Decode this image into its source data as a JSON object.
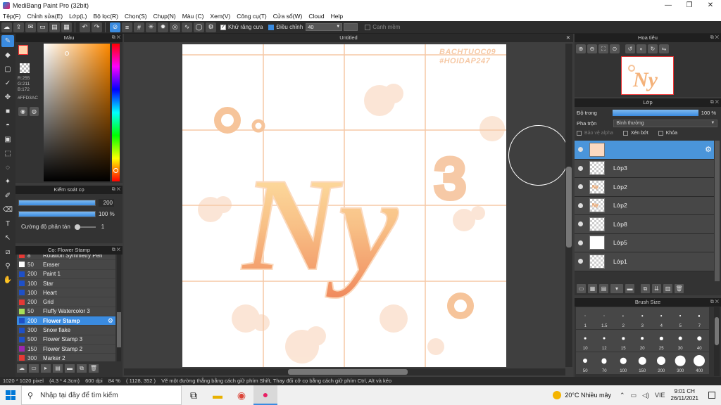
{
  "window": {
    "title": "MediBang Paint Pro (32bit)",
    "minimize": "—",
    "maximize": "❐",
    "close": "✕"
  },
  "menu": [
    "Tệp(F)",
    "Chỉnh sửa(E)",
    "Lớp(L)",
    "Bộ lọc(R)",
    "Chọn(S)",
    "Chụp(N)",
    "Màu (C)",
    "Xem(V)",
    "Công cụ(T)",
    "Cửa sổ(W)",
    "Cloud",
    "Help"
  ],
  "toolbar": {
    "antialias_label": "Khử răng cưa",
    "antialias_checked": true,
    "correction_label": "Điều chỉnh",
    "correction_value": "40",
    "snap_label": "Canh mềm",
    "snap_checked": false
  },
  "color_panel": {
    "title": "Màu",
    "foreground_color": "#FFD3AC",
    "r": "R:255",
    "g": "G:211",
    "b": "B:172",
    "hex": "#FFD3AC"
  },
  "brush_control": {
    "title": "Kiểm soát cọ",
    "size_value": "200",
    "opacity_value": "100 %",
    "scatter_label": "Cường độ phân tán",
    "scatter_value": "1"
  },
  "brush_list": {
    "title": "Cọ: Flower Stamp",
    "items": [
      {
        "size": "8",
        "name": "Rotation Symmetry Pen",
        "color": "#e53935",
        "selected": false
      },
      {
        "size": "50",
        "name": "Eraser",
        "color": "#ffffff",
        "selected": false
      },
      {
        "size": "200",
        "name": "Paint 1",
        "color": "#1e50c8",
        "selected": false
      },
      {
        "size": "100",
        "name": "Star",
        "color": "#1e50c8",
        "selected": false
      },
      {
        "size": "100",
        "name": "Heart",
        "color": "#1e50c8",
        "selected": false
      },
      {
        "size": "200",
        "name": "Grid",
        "color": "#e53935",
        "selected": false
      },
      {
        "size": "50",
        "name": "Fluffy Watercolor 3",
        "color": "#a6e05a",
        "selected": false
      },
      {
        "size": "200",
        "name": "Flower Stamp",
        "color": "#1e50c8",
        "selected": true
      },
      {
        "size": "300",
        "name": "Snow flake",
        "color": "#1e50c8",
        "selected": false
      },
      {
        "size": "500",
        "name": "Flower Stamp 3",
        "color": "#1e50c8",
        "selected": false
      },
      {
        "size": "150",
        "name": "Flower Stamp 2",
        "color": "#9c27b0",
        "selected": false
      },
      {
        "size": "300",
        "name": "Marker 2",
        "color": "#e53935",
        "selected": false
      }
    ]
  },
  "canvas": {
    "tab_title": "Untitled",
    "watermark_line1": "BACHTUOC09",
    "watermark_line2": "#HOIDAP247",
    "art_text": "Ny",
    "art_superscript": "3"
  },
  "navigator": {
    "title": "Hoa tiêu"
  },
  "layer_panel": {
    "title": "Lớp",
    "opacity_label": "Độ trong",
    "opacity_value": "100 %",
    "blend_label": "Pha trộn",
    "blend_value": "Bình thường",
    "protect_alpha": "Bảo vệ alpha",
    "clipping": "Xén bớt",
    "lock": "Khóa",
    "layers": [
      {
        "name": "",
        "selected": true,
        "thumb": "peach"
      },
      {
        "name": "Lớp3",
        "selected": false,
        "thumb": "empty"
      },
      {
        "name": "Lớp2",
        "selected": false,
        "thumb": "ny"
      },
      {
        "name": "Lớp2",
        "selected": false,
        "thumb": "ny"
      },
      {
        "name": "Lớp8",
        "selected": false,
        "thumb": "empty"
      },
      {
        "name": "Lớp5",
        "selected": false,
        "thumb": "white"
      },
      {
        "name": "Lớp1",
        "selected": false,
        "thumb": "empty"
      }
    ]
  },
  "brush_size_panel": {
    "title": "Brush Size",
    "sizes": [
      "1",
      "1.5",
      "2",
      "3",
      "4",
      "5",
      "7",
      "10",
      "12",
      "15",
      "20",
      "25",
      "30",
      "40",
      "50",
      "70",
      "100",
      "150",
      "200",
      "300",
      "400"
    ]
  },
  "statusbar": {
    "canvas_size": "1020 * 1020 pixel",
    "physical_size": "(4.3 * 4.3cm)",
    "dpi": "600 dpi",
    "zoom": "84 %",
    "cursor": "( 1128, 352 )",
    "hint": "Vẽ một đường thẳng bằng cách giữ phím Shift, Thay đổi cỡ cọ bằng cách giữ phím Ctrl, Alt và kéo"
  },
  "taskbar": {
    "search_placeholder": "Nhập tại đây để tìm kiếm",
    "weather": "20°C Nhiều mây",
    "language": "VIE",
    "time": "9:01 CH",
    "date": "26/11/2021"
  }
}
